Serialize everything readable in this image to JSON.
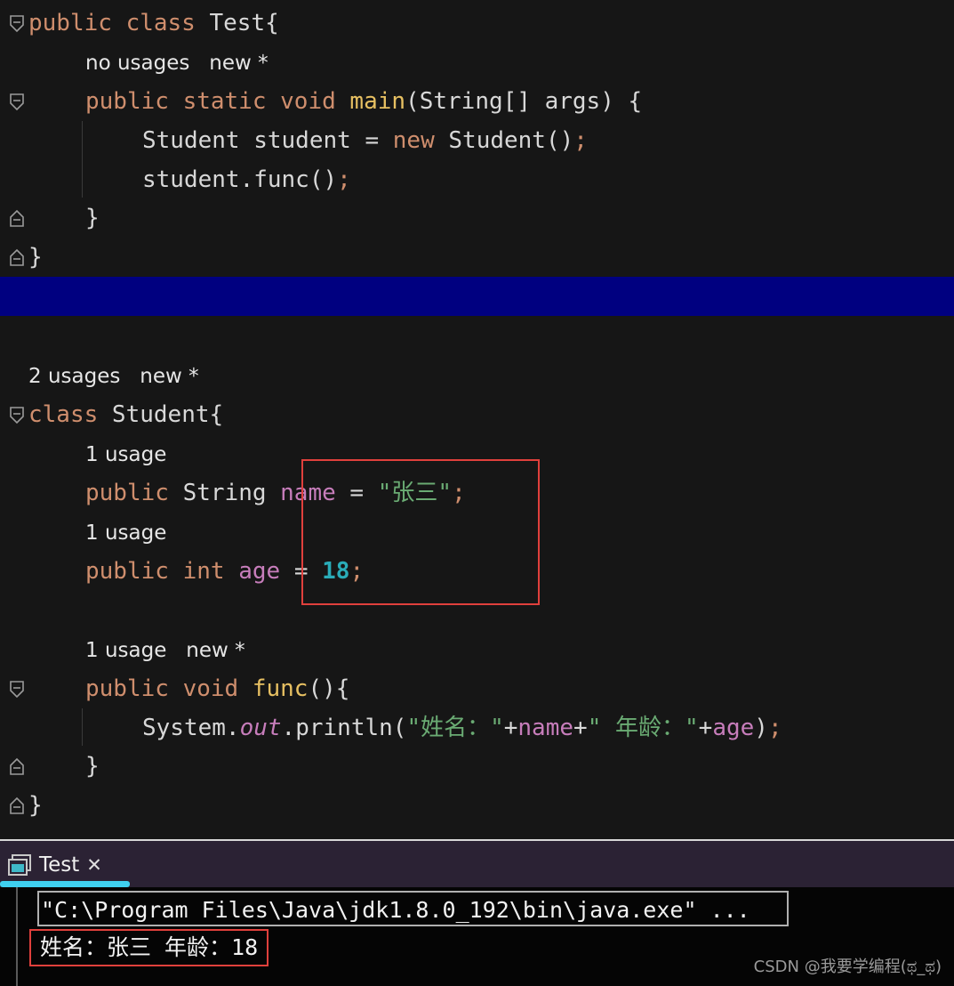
{
  "code": {
    "line1": {
      "kw": "public class",
      "name": "Test{"
    },
    "hint1": "no usages   new *",
    "line2": {
      "kw": "public static void",
      "fn": "main",
      "rest": "(String[] args) {"
    },
    "line3": {
      "a": "Student student = ",
      "kw": "new",
      "b": " Student()",
      "sep": ";"
    },
    "line4": {
      "a": "student.func()",
      "sep": ";"
    },
    "line5": "}",
    "line6": "}",
    "hint2": "2 usages   new *",
    "line7": {
      "kw": "class",
      "name": " Student{"
    },
    "hint3": "1 usage",
    "line8": {
      "kw": "public",
      "a": " String ",
      "fld": "name",
      "b": " = ",
      "str": "\"张三\"",
      "sep": ";"
    },
    "hint4": "1 usage",
    "line9": {
      "kw": "public int",
      "a": " ",
      "fld": "age",
      "b": " = ",
      "num": "18",
      "sep": ";"
    },
    "hint5": "1 usage   new *",
    "line10": {
      "kw": "public void",
      "fn": "func",
      "rest": "(){"
    },
    "line11": {
      "a": "System.",
      "it": "out",
      "b": ".println(",
      "str1": "\"姓名：\"",
      "c": "+",
      "fld1": "name",
      "d": "+",
      "str2": "\" 年龄：\"",
      "e": "+",
      "fld2": "age",
      "f": ")",
      "sep": ";"
    },
    "line12": "}",
    "line13": "}"
  },
  "run": {
    "tab_label": "Test",
    "close_glyph": "✕",
    "command": "\"C:\\Program Files\\Java\\jdk1.8.0_192\\bin\\java.exe\" ...",
    "output": "姓名：张三 年龄：18"
  },
  "watermark": "CSDN @我要学编程(ಥ_ಥ)"
}
